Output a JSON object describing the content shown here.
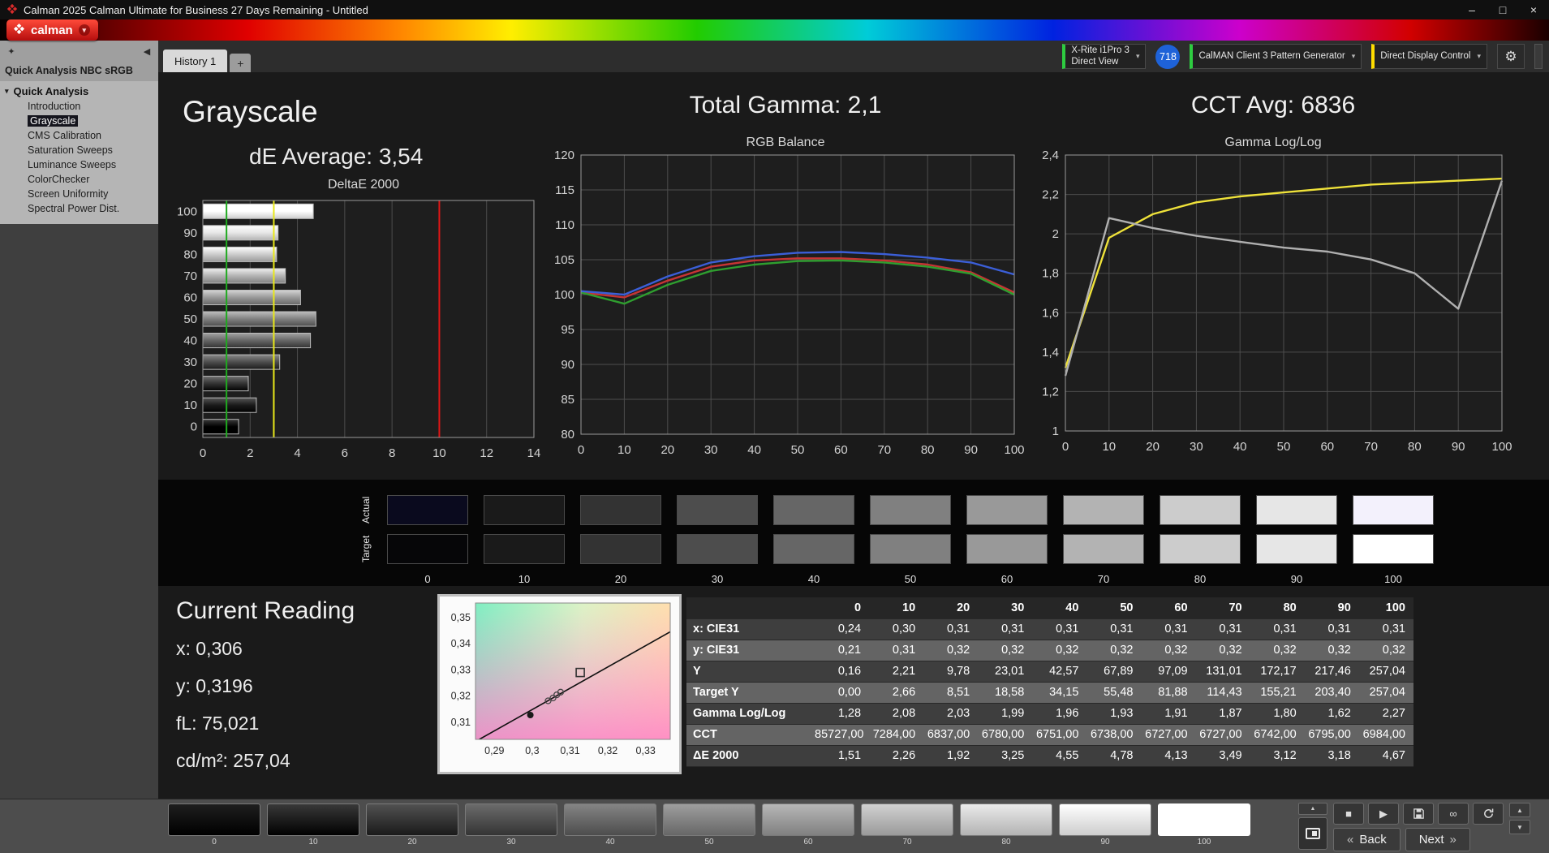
{
  "titlebar": {
    "title": "Calman 2025 Calman Ultimate for Business 27 Days Remaining  - Untitled"
  },
  "icons": {
    "minimize": "–",
    "maximize": "□",
    "close": "×",
    "caret_down": "▾",
    "collapse_left": "◀",
    "menu_star": "✦",
    "gear": "⚙",
    "stop": "■",
    "play": "▶",
    "infinity": "∞",
    "back_arrows": "«",
    "next_arrows": "»",
    "up_small": "▲",
    "down_small": "▼"
  },
  "logo": {
    "text": "calman"
  },
  "tabs": {
    "history": "History 1",
    "add": "+"
  },
  "toolbar": {
    "meter": {
      "line1": "X-Rite i1Pro 3",
      "line2": "Direct View",
      "accent": "#2ecc40"
    },
    "badge": "718",
    "badge_color": "#1e62d8",
    "pattern_gen": {
      "label": "CalMAN Client 3 Pattern Generator",
      "accent": "#2ecc40"
    },
    "display_ctrl": {
      "label": "Direct Display Control",
      "accent": "#ffdd00"
    }
  },
  "sidebar": {
    "title": "Quick Analysis NBC sRGB",
    "root": "Quick Analysis",
    "items": [
      {
        "label": "Introduction",
        "selected": false
      },
      {
        "label": "Grayscale",
        "selected": true
      },
      {
        "label": "CMS Calibration",
        "selected": false
      },
      {
        "label": "Saturation Sweeps",
        "selected": false
      },
      {
        "label": "Luminance Sweeps",
        "selected": false
      },
      {
        "label": "ColorChecker",
        "selected": false
      },
      {
        "label": "Screen Uniformity",
        "selected": false
      },
      {
        "label": "Spectral Power Dist.",
        "selected": false
      }
    ]
  },
  "headings": {
    "grayscale": "Grayscale",
    "de_average": "dE Average: 3,54",
    "total_gamma": "Total Gamma: 2,1",
    "cct_avg": "CCT Avg: 6836"
  },
  "chart_data": [
    {
      "type": "bar",
      "title": "DeltaE 2000",
      "orientation": "horizontal",
      "categories": [
        100,
        90,
        80,
        70,
        60,
        50,
        40,
        30,
        20,
        10,
        0
      ],
      "values": [
        4.67,
        3.18,
        3.12,
        3.49,
        4.13,
        4.78,
        4.55,
        3.25,
        1.92,
        2.26,
        1.51
      ],
      "xlim": [
        0,
        14
      ],
      "xticks": [
        0,
        2,
        4,
        6,
        8,
        10,
        12,
        14
      ],
      "ref_lines": [
        {
          "x": 1,
          "color": "#1faa1f"
        },
        {
          "x": 3,
          "color": "#e8e81a"
        },
        {
          "x": 10,
          "color": "#e01515"
        }
      ]
    },
    {
      "type": "line",
      "title": "RGB Balance",
      "x": [
        0,
        10,
        20,
        30,
        40,
        50,
        60,
        70,
        80,
        90,
        100
      ],
      "xticks": [
        0,
        10,
        20,
        30,
        40,
        50,
        60,
        70,
        80,
        90,
        100
      ],
      "ylim": [
        80,
        120
      ],
      "yticks": [
        80,
        85,
        90,
        95,
        100,
        105,
        110,
        115,
        120
      ],
      "series": [
        {
          "name": "Red",
          "color": "#c63434",
          "values": [
            100.3,
            99.6,
            102.0,
            104.0,
            104.9,
            105.2,
            105.2,
            104.9,
            104.3,
            103.2,
            100.3
          ]
        },
        {
          "name": "Green",
          "color": "#2f9e2f",
          "values": [
            100.3,
            98.7,
            101.4,
            103.4,
            104.3,
            104.8,
            104.9,
            104.6,
            104.0,
            103.0,
            100.0
          ]
        },
        {
          "name": "Blue",
          "color": "#3b5fd8",
          "values": [
            100.5,
            100.0,
            102.6,
            104.6,
            105.5,
            106.0,
            106.1,
            105.8,
            105.3,
            104.6,
            102.9
          ]
        }
      ]
    },
    {
      "type": "line",
      "title": "Gamma Log/Log",
      "x": [
        0,
        10,
        20,
        30,
        40,
        50,
        60,
        70,
        80,
        90,
        100
      ],
      "xticks": [
        0,
        10,
        20,
        30,
        40,
        50,
        60,
        70,
        80,
        90,
        100
      ],
      "ylim": [
        1,
        2.4
      ],
      "yticks": [
        1,
        1.2,
        1.4,
        1.6,
        1.8,
        2,
        2.2,
        2.4
      ],
      "series": [
        {
          "name": "Target",
          "color": "#efe23a",
          "values": [
            1.32,
            1.98,
            2.1,
            2.16,
            2.19,
            2.21,
            2.23,
            2.25,
            2.26,
            2.27,
            2.28
          ]
        },
        {
          "name": "Measured",
          "color": "#b0b0b0",
          "values": [
            1.28,
            2.08,
            2.03,
            1.99,
            1.96,
            1.93,
            1.91,
            1.87,
            1.8,
            1.62,
            2.27
          ]
        }
      ]
    },
    {
      "type": "scatter",
      "name": "cie-detail",
      "xlim": [
        0.285,
        0.3365
      ],
      "ylim": [
        0.3035,
        0.3555
      ],
      "xticks": [
        0.29,
        0.3,
        0.31,
        0.32,
        0.33
      ],
      "yticks": [
        0.31,
        0.32,
        0.33,
        0.34,
        0.35
      ],
      "locus_line": [
        [
          0.286,
          0.3035
        ],
        [
          0.3365,
          0.3445
        ]
      ],
      "points": [
        {
          "x": 0.3127,
          "y": 0.329,
          "marker": "square-open"
        },
        {
          "x": 0.3075,
          "y": 0.3215,
          "marker": "circle-open"
        },
        {
          "x": 0.3065,
          "y": 0.3205,
          "marker": "circle-open"
        },
        {
          "x": 0.3055,
          "y": 0.3193,
          "marker": "circle-open"
        },
        {
          "x": 0.3042,
          "y": 0.3182,
          "marker": "circle-open"
        },
        {
          "x": 0.2995,
          "y": 0.3128,
          "marker": "circle-filled"
        }
      ]
    }
  ],
  "swatch_strip": {
    "row_labels": [
      "Actual",
      "Target"
    ],
    "levels": [
      "0",
      "10",
      "20",
      "30",
      "40",
      "50",
      "60",
      "70",
      "80",
      "90",
      "100"
    ],
    "actual_zero_tint": "#0a0a1e",
    "target_zero_tint": "#060608",
    "actual_hundred_tint": "#f3f1fc"
  },
  "current_reading": {
    "title": "Current Reading",
    "lines": [
      {
        "key": "x",
        "label": "x:",
        "value": "0,306"
      },
      {
        "key": "y",
        "label": "y:",
        "value": "0,3196"
      },
      {
        "key": "fl",
        "label": "fL:",
        "value": "75,021"
      },
      {
        "key": "cdm2",
        "label": "cd/m²:",
        "value": "257,04"
      }
    ]
  },
  "table": {
    "columns": [
      "0",
      "10",
      "20",
      "30",
      "40",
      "50",
      "60",
      "70",
      "80",
      "90",
      "100"
    ],
    "rows": [
      {
        "label": "x: CIE31",
        "values": [
          "0,24",
          "0,30",
          "0,31",
          "0,31",
          "0,31",
          "0,31",
          "0,31",
          "0,31",
          "0,31",
          "0,31",
          "0,31"
        ]
      },
      {
        "label": "y: CIE31",
        "values": [
          "0,21",
          "0,31",
          "0,32",
          "0,32",
          "0,32",
          "0,32",
          "0,32",
          "0,32",
          "0,32",
          "0,32",
          "0,32"
        ]
      },
      {
        "label": "Y",
        "values": [
          "0,16",
          "2,21",
          "9,78",
          "23,01",
          "42,57",
          "67,89",
          "97,09",
          "131,01",
          "172,17",
          "217,46",
          "257,04"
        ]
      },
      {
        "label": "Target Y",
        "values": [
          "0,00",
          "2,66",
          "8,51",
          "18,58",
          "34,15",
          "55,48",
          "81,88",
          "114,43",
          "155,21",
          "203,40",
          "257,04"
        ]
      },
      {
        "label": "Gamma Log/Log",
        "values": [
          "1,28",
          "2,08",
          "2,03",
          "1,99",
          "1,96",
          "1,93",
          "1,91",
          "1,87",
          "1,80",
          "1,62",
          "2,27"
        ]
      },
      {
        "label": "CCT",
        "values": [
          "85727,00",
          "7284,00",
          "6837,00",
          "6780,00",
          "6751,00",
          "6738,00",
          "6727,00",
          "6727,00",
          "6742,00",
          "6795,00",
          "6984,00"
        ]
      },
      {
        "label": "ΔE 2000",
        "values": [
          "1,51",
          "2,26",
          "1,92",
          "3,25",
          "4,55",
          "4,78",
          "4,13",
          "3,49",
          "3,12",
          "3,18",
          "4,67"
        ]
      }
    ]
  },
  "bottombar": {
    "levels": [
      "0",
      "10",
      "20",
      "30",
      "40",
      "50",
      "60",
      "70",
      "80",
      "90",
      "100"
    ],
    "selected_level": "100",
    "back_label": "Back",
    "next_label": "Next"
  }
}
